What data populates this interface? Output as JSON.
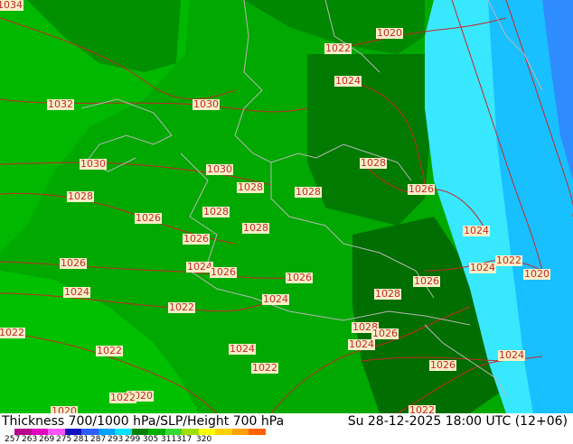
{
  "map": {
    "isobar_labels": [
      "1034",
      "1032",
      "1030",
      "1030",
      "1030",
      "1028",
      "1026",
      "1028",
      "1026",
      "1028",
      "1028",
      "1024",
      "1022",
      "1024",
      "1022",
      "1022",
      "1026",
      "1026",
      "1028",
      "1028",
      "1026",
      "1024",
      "1026",
      "1028",
      "1028",
      "1024",
      "1026",
      "1026",
      "1020",
      "1022",
      "1020",
      "1024",
      "1022",
      "1024",
      "1024",
      "1020",
      "1026",
      "1028",
      "1026",
      "1024",
      "1022",
      "1020",
      "1022",
      "1024",
      "1022",
      "1022",
      "1020"
    ]
  },
  "footer": {
    "title": "Thickness 700/1000 hPa/SLP/Height 700 hPa",
    "datetime": "Su 28-12-2025 18:00 UTC (12+06)"
  },
  "legend": {
    "ticks": [
      "257",
      "263",
      "269",
      "275",
      "281",
      "287",
      "293",
      "299",
      "305",
      "311",
      "317",
      "320"
    ],
    "colors": [
      "#b8008c",
      "#e000c0",
      "#ff55ff",
      "#1010c0",
      "#2e5cff",
      "#00a0ff",
      "#00e0ff",
      "#008000",
      "#00b000",
      "#38d838",
      "#a0e000",
      "#ffff00",
      "#ffd000",
      "#ffa000",
      "#ff6000"
    ]
  },
  "colors": {
    "thickness_dark_green": "#007a00",
    "thickness_green": "#009600",
    "thickness_light_green": "#00b400",
    "thickness_cyan": "#38e8ff",
    "thickness_light_blue": "#18c0ff",
    "isobar": "#c62828",
    "border": "#b8b8b8"
  }
}
